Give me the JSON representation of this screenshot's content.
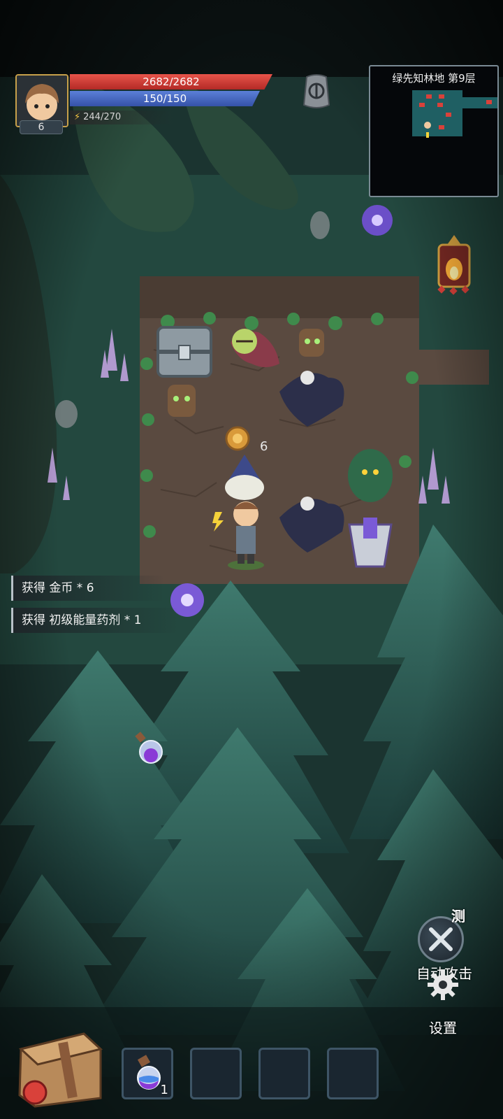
{
  "player": {
    "level": "6",
    "hp": "2682/2682",
    "mp": "150/150",
    "energy": "244/270"
  },
  "minimap": {
    "title": "绿先知林地 第9层"
  },
  "messages": [
    {
      "text": "获得 金币 * 6"
    },
    {
      "text": "获得 初级能量药剂 * 1"
    }
  ],
  "drop": {
    "coin_amount": "6"
  },
  "buttons": {
    "auto_attack_label": "自动攻击",
    "test_tag": "测",
    "settings_label": "设置"
  },
  "inventory": {
    "slots": [
      {
        "item": "potion-icon",
        "count": "1"
      },
      {
        "item": "",
        "count": ""
      },
      {
        "item": "",
        "count": ""
      },
      {
        "item": "",
        "count": ""
      }
    ]
  },
  "colors": {
    "hp": "#d9413a",
    "mp": "#4a6cc4",
    "forest": "#1f3b36",
    "floor": "#5a4a40"
  }
}
